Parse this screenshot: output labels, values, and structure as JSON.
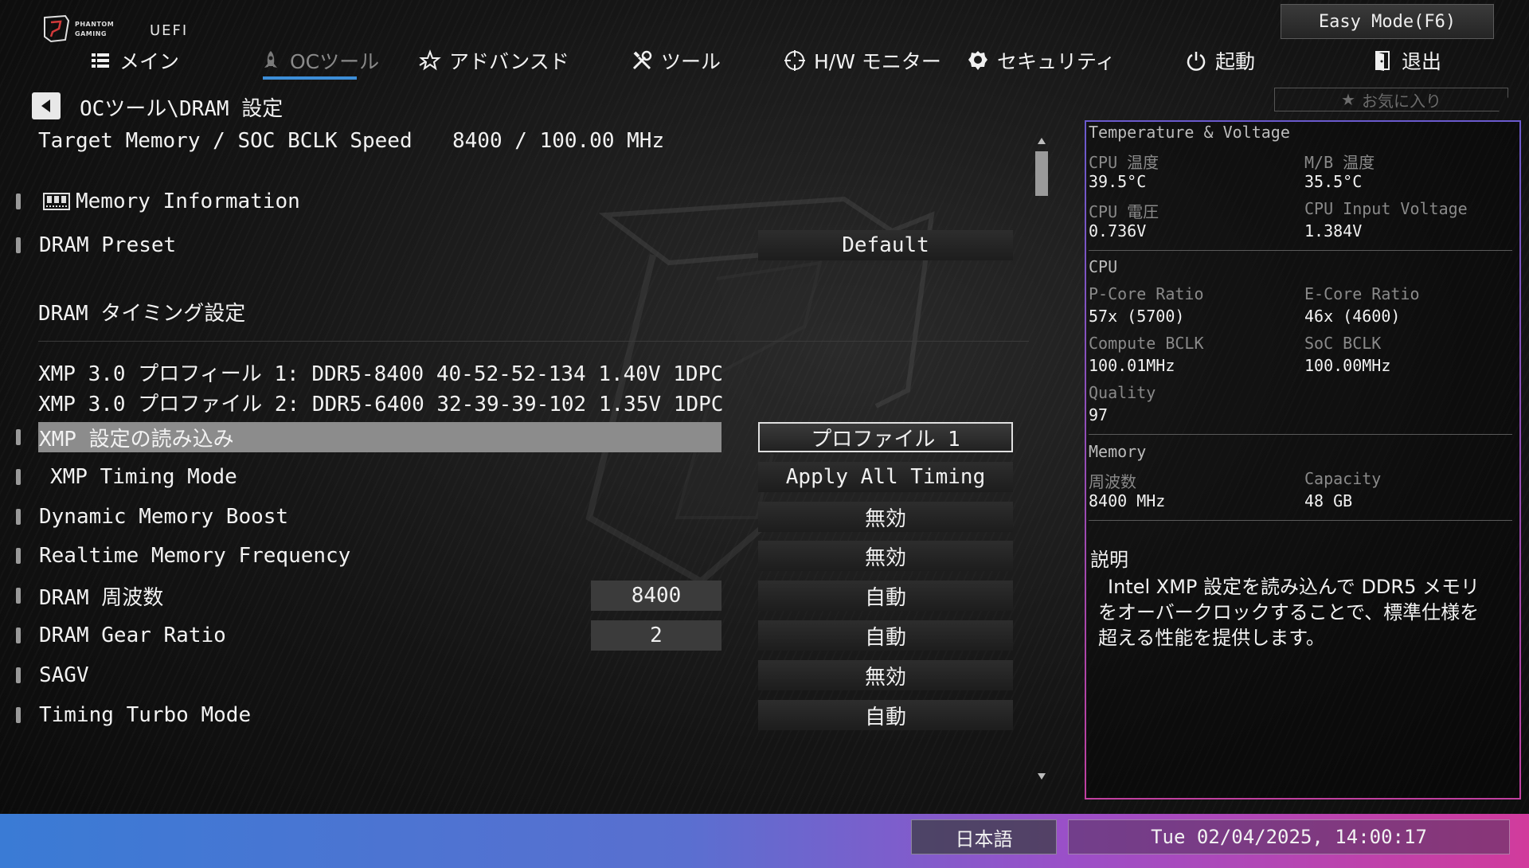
{
  "header": {
    "logo_text": "PHANTOM GAMING",
    "uefi_label": "UEFI",
    "easy_mode_label": "Easy Mode(F6)"
  },
  "tabs": [
    {
      "label": "メイン",
      "icon": "list-icon"
    },
    {
      "label": "OCツール",
      "icon": "rocket-icon",
      "active": true
    },
    {
      "label": "アドバンスド",
      "icon": "star-icon"
    },
    {
      "label": "ツール",
      "icon": "tools-icon"
    },
    {
      "label": "H/W モニター",
      "icon": "crosshair-icon"
    },
    {
      "label": "セキュリティ",
      "icon": "shield-icon"
    },
    {
      "label": "起動",
      "icon": "power-icon"
    },
    {
      "label": "退出",
      "icon": "exit-door-icon"
    }
  ],
  "breadcrumb": "OCツール\\DRAM 設定",
  "favorite_label": "お気に入り",
  "settings": {
    "target_speed_label": "Target Memory / SOC BCLK Speed",
    "target_speed_value": "8400 / 100.00 MHz",
    "memory_information": "Memory Information",
    "dram_preset": {
      "label": "DRAM Preset",
      "value": "Default"
    },
    "dram_timing_header": "DRAM タイミング設定",
    "xmp_profile_1": "XMP 3.0 プロフィール 1: DDR5-8400 40-52-52-134 1.40V 1DPC",
    "xmp_profile_2": "XMP 3.0 プロファイル 2: DDR5-6400 32-39-39-102 1.35V 1DPC",
    "load_xmp": {
      "label": "XMP 設定の読み込み",
      "value": "プロファイル 1"
    },
    "xmp_timing_mode": {
      "label": "XMP Timing Mode",
      "value": "Apply All Timing"
    },
    "dynamic_memory_boost": {
      "label": "Dynamic Memory Boost",
      "value": "無効"
    },
    "realtime_memory_frequency": {
      "label": "Realtime Memory Frequency",
      "value": "無効"
    },
    "dram_frequency": {
      "label": "DRAM 周波数",
      "current": "8400",
      "value": "自動"
    },
    "dram_gear_ratio": {
      "label": "DRAM Gear Ratio",
      "current": "2",
      "value": "自動"
    },
    "sagv": {
      "label": "SAGV",
      "value": "無効"
    },
    "timing_turbo_mode": {
      "label": "Timing Turbo Mode",
      "value": "自動"
    }
  },
  "monitor": {
    "title": "Temperature & Voltage",
    "cpu_temp_label": "CPU 温度",
    "cpu_temp": "39.5°C",
    "mb_temp_label": "M/B 温度",
    "mb_temp": "35.5°C",
    "cpu_voltage_label": "CPU 電圧",
    "cpu_voltage": "0.736V",
    "cpu_input_voltage_label": "CPU Input Voltage",
    "cpu_input_voltage": "1.384V",
    "cpu_section": "CPU",
    "pcore_ratio_label": "P-Core Ratio",
    "pcore_ratio": "57x (5700)",
    "ecore_ratio_label": "E-Core Ratio",
    "ecore_ratio": "46x (4600)",
    "compute_bclk_label": "Compute BCLK",
    "compute_bclk": "100.01MHz",
    "soc_bclk_label": "SoC BCLK",
    "soc_bclk": "100.00MHz",
    "quality_label": "Quality",
    "quality": "97",
    "memory_section": "Memory",
    "frequency_label": "周波数",
    "frequency": "8400 MHz",
    "capacity_label": "Capacity",
    "capacity": "48 GB"
  },
  "description": {
    "title": "説明",
    "text": "Intel XMP 設定を読み込んで DDR5 メモリをオーバークロックすることで、標準仕様を超える性能を提供します。"
  },
  "footer": {
    "language": "日本語",
    "datetime": "Tue 02/04/2025, 14:00:17"
  },
  "colors": {
    "accent": "#3d8ed8",
    "bottom_gradient_start": "#3a7bd5",
    "bottom_gradient_end": "#d13b9c",
    "panel_border_top": "#6a5acd",
    "panel_border_bottom": "#c040a0"
  }
}
